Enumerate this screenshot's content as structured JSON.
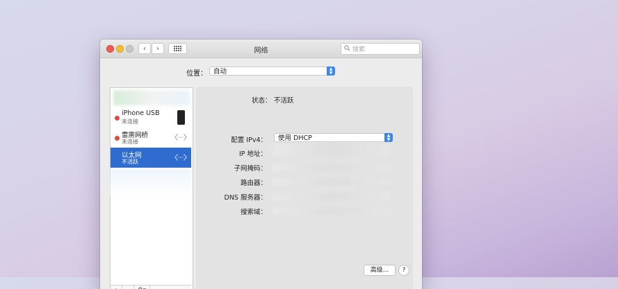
{
  "window": {
    "title": "网络"
  },
  "search": {
    "placeholder": "搜索"
  },
  "location": {
    "label": "位置：",
    "value": "自动"
  },
  "services": [
    {
      "name": "iPhone USB",
      "status": "未连接",
      "dot_color": "#e04a40",
      "icon": "iphone-icon"
    },
    {
      "name": "雷雳网桥",
      "status": "未连接",
      "dot_color": "#e04a40",
      "icon": "ethernet-arrows-icon"
    },
    {
      "name": "以太网",
      "status": "不活跃",
      "dot_color": "#e04a40",
      "icon": "ethernet-arrows-icon",
      "selected": true
    }
  ],
  "sidebar_tools": {
    "add": "+",
    "remove": "−",
    "gear": "⚙▾"
  },
  "detail": {
    "status_label": "状态：",
    "status_value": "不活跃",
    "configure_ipv4_label": "配置 IPv4：",
    "configure_ipv4_value": "使用 DHCP",
    "ip_label": "IP 地址：",
    "subnet_label": "子网掩码：",
    "router_label": "路由器：",
    "dns_label": "DNS 服务器：",
    "search_domains_label": "搜索域：",
    "advanced_button": "高级...",
    "help_button": "?"
  },
  "colors": {
    "accent": "#3b86e8",
    "selection": "#2f6ccf",
    "status_inactive": "#e04a40"
  }
}
